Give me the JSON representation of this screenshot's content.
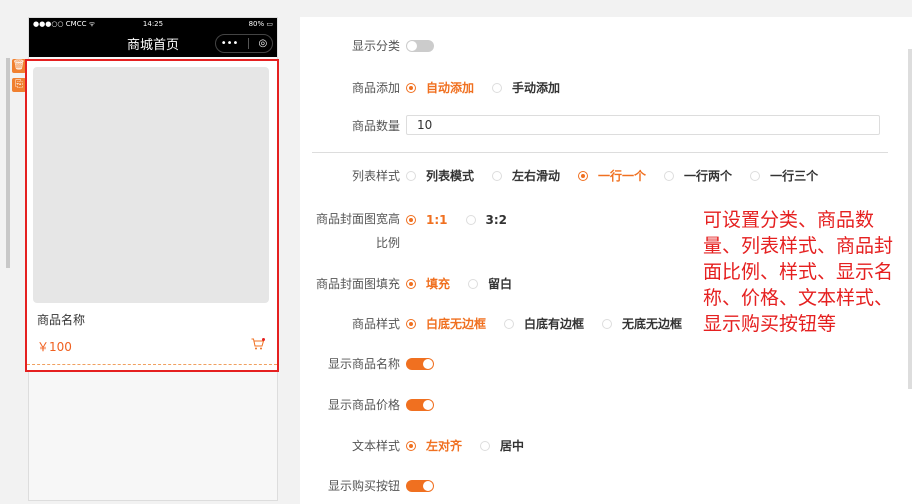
{
  "phone": {
    "status_carrier": "●●●○○ CMCC ᯤ",
    "status_time": "14:25",
    "status_battery": "80% ▭",
    "nav_title": "商城首页",
    "capsule_more": "•••",
    "capsule_close": "◎"
  },
  "card": {
    "name": "商品名称",
    "price": "￥100"
  },
  "icons": {
    "delete": "🗑",
    "copy": "⎘"
  },
  "settings": {
    "show_category": {
      "label": "显示分类",
      "on": false
    },
    "product_add": {
      "label": "商品添加",
      "options": [
        "自动添加",
        "手动添加"
      ],
      "selected": 0
    },
    "product_count": {
      "label": "商品数量",
      "value": "10"
    },
    "list_style": {
      "label": "列表样式",
      "options": [
        "列表模式",
        "左右滑动",
        "一行一个",
        "一行两个",
        "一行三个"
      ],
      "selected": 2
    },
    "cover_ratio": {
      "label_line1": "商品封面图宽高",
      "label_line2": "比例",
      "options": [
        "1:1",
        "3:2"
      ],
      "selected": 0
    },
    "cover_fill": {
      "label": "商品封面图填充",
      "options": [
        "填充",
        "留白"
      ],
      "selected": 0
    },
    "product_style": {
      "label": "商品样式",
      "options": [
        "白底无边框",
        "白底有边框",
        "无底无边框"
      ],
      "selected": 0
    },
    "show_name": {
      "label": "显示商品名称",
      "on": true
    },
    "show_price": {
      "label": "显示商品价格",
      "on": true
    },
    "text_style": {
      "label": "文本样式",
      "options": [
        "左对齐",
        "居中"
      ],
      "selected": 0
    },
    "show_buy": {
      "label": "显示购买按钮",
      "on": true
    }
  },
  "annotation": "可设置分类、商品数量、列表样式、商品封面比例、样式、显示名称、价格、文本样式、显示购买按钮等",
  "colors": {
    "accent": "#f07020",
    "annotation": "#e52020"
  }
}
